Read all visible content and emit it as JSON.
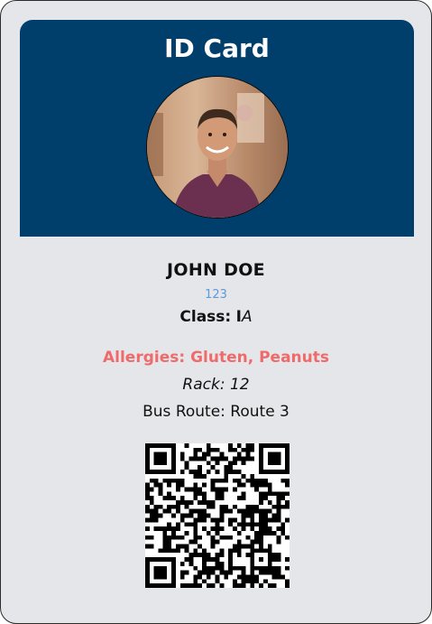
{
  "card": {
    "title": "ID Card",
    "name": "JOHN DOE",
    "id_number": "123",
    "class_label": "Class:",
    "class_grade": "I",
    "class_section": "A",
    "allergies": "Allergies: Gluten, Peanuts",
    "rack": "Rack: 12",
    "bus_route": "Bus Route: Route 3"
  },
  "colors": {
    "card_background": "#e5e6ea",
    "header_background": "#003f6b",
    "title_text": "#ffffff",
    "id_number": "#5b9bd8",
    "allergies": "#ef6b6b"
  },
  "icons": {
    "photo": "student-photo",
    "qr": "qr-code"
  }
}
